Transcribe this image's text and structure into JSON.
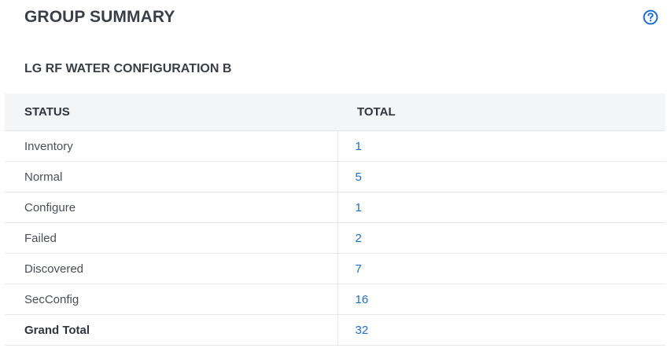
{
  "header": {
    "title": "GROUP SUMMARY",
    "help_icon": "question-circle-icon"
  },
  "group": {
    "name": "LG RF WATER CONFIGURATION B"
  },
  "table": {
    "columns": [
      "STATUS",
      "TOTAL"
    ],
    "rows": [
      {
        "status": "Inventory",
        "total": "1"
      },
      {
        "status": "Normal",
        "total": "5"
      },
      {
        "status": "Configure",
        "total": "1"
      },
      {
        "status": "Failed",
        "total": "2"
      },
      {
        "status": "Discovered",
        "total": "7"
      },
      {
        "status": "SecConfig",
        "total": "16"
      }
    ],
    "grand_total": {
      "label": "Grand Total",
      "total": "32"
    }
  },
  "colors": {
    "link": "#1f6fc5",
    "header_bg": "#f4f5f7",
    "text": "#3a3f47"
  }
}
